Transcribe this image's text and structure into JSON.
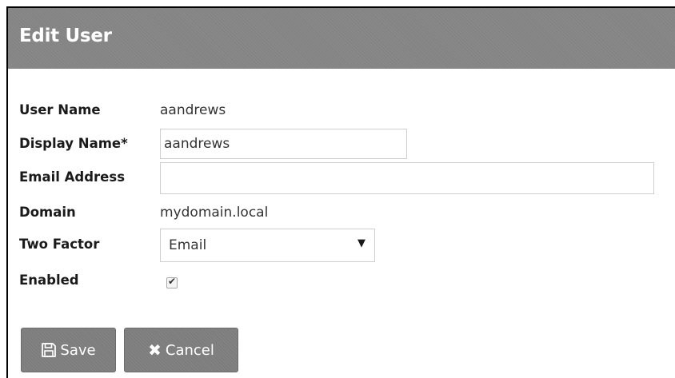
{
  "dialog": {
    "title": "Edit User"
  },
  "form": {
    "user_name": {
      "label": "User Name",
      "value": "aandrews"
    },
    "display_name": {
      "label": "Display Name",
      "required_marker": "*",
      "value": "aandrews"
    },
    "email_address": {
      "label": "Email Address",
      "value": ""
    },
    "domain": {
      "label": "Domain",
      "value": "mydomain.local"
    },
    "two_factor": {
      "label": "Two Factor",
      "selected": "Email",
      "arrow": "▼"
    },
    "enabled": {
      "label": "Enabled",
      "checked": true,
      "check_glyph": "✔"
    }
  },
  "buttons": {
    "save": {
      "label": "Save",
      "icon": "save-icon"
    },
    "cancel": {
      "label": "Cancel",
      "icon": "close-icon",
      "glyph": "✖"
    }
  },
  "colors": {
    "header_bg": "#848484",
    "button_bg": "#7d7d7d",
    "text": "#1a1a1a"
  }
}
